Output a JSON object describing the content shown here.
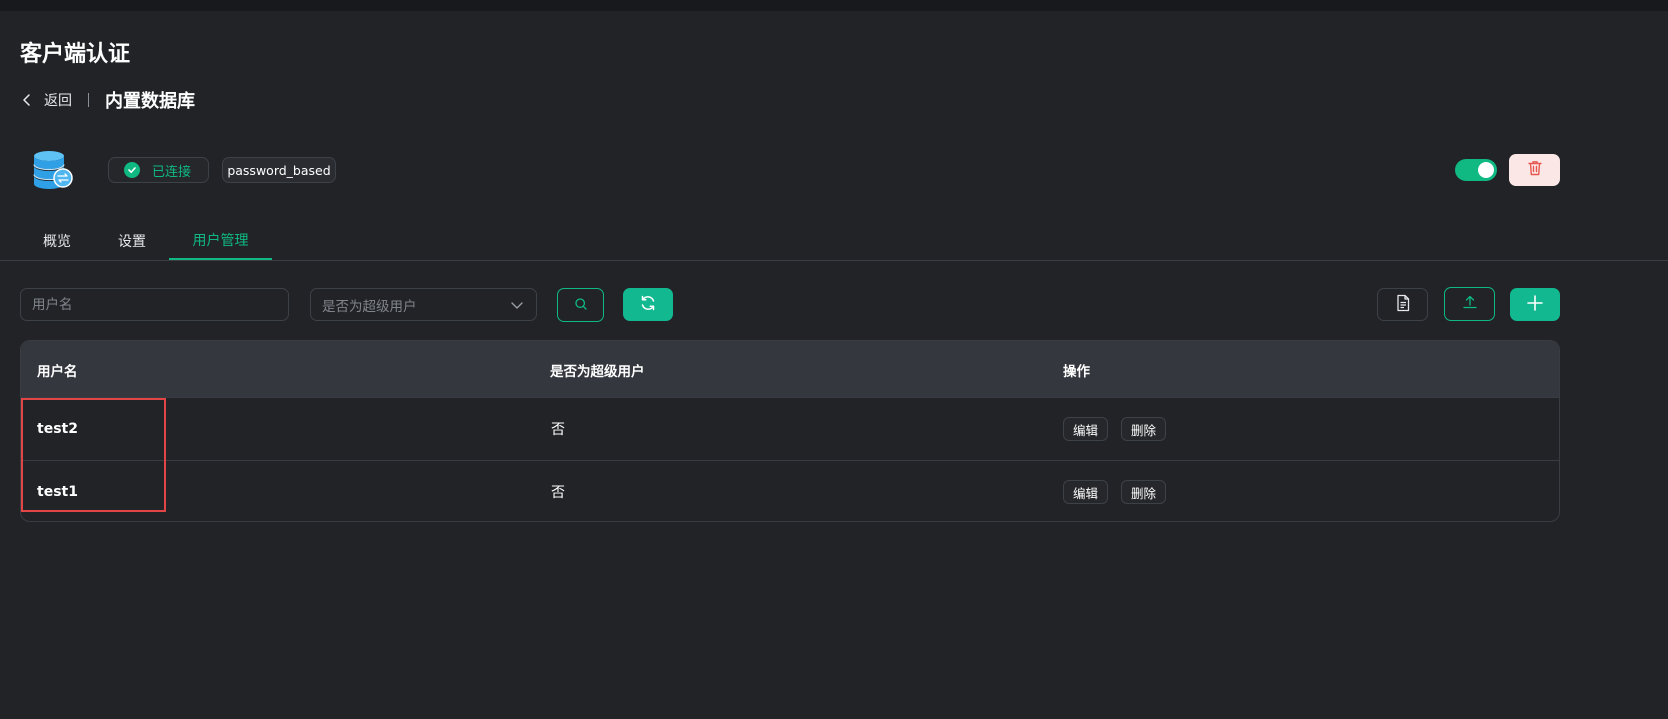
{
  "page": {
    "title": "客户端认证"
  },
  "breadcrumb": {
    "back_label": "返回",
    "current": "内置数据库"
  },
  "resource": {
    "status": "已连接",
    "auth_type": "password_based",
    "enabled": true
  },
  "tabs": [
    {
      "label": "概览",
      "active": false
    },
    {
      "label": "设置",
      "active": false
    },
    {
      "label": "用户管理",
      "active": true
    }
  ],
  "filters": {
    "username_placeholder": "用户名",
    "superuser_placeholder": "是否为超级用户"
  },
  "table": {
    "columns": [
      "用户名",
      "是否为超级用户",
      "操作"
    ],
    "rows": [
      {
        "username": "test2",
        "is_superuser": "否",
        "actions": [
          "编辑",
          "删除"
        ]
      },
      {
        "username": "test1",
        "is_superuser": "否",
        "actions": [
          "编辑",
          "删除"
        ]
      }
    ]
  },
  "colors": {
    "accent": "#10b981",
    "danger": "#e5574f",
    "background": "#212327"
  },
  "icons": {
    "back": "chevron-left-icon",
    "database": "database-icon",
    "status": "check-circle-icon",
    "delete": "trash-icon",
    "search": "search-icon",
    "refresh": "refresh-icon",
    "doc": "document-icon",
    "upload": "upload-icon",
    "add": "plus-icon",
    "caret": "chevron-down-icon"
  }
}
